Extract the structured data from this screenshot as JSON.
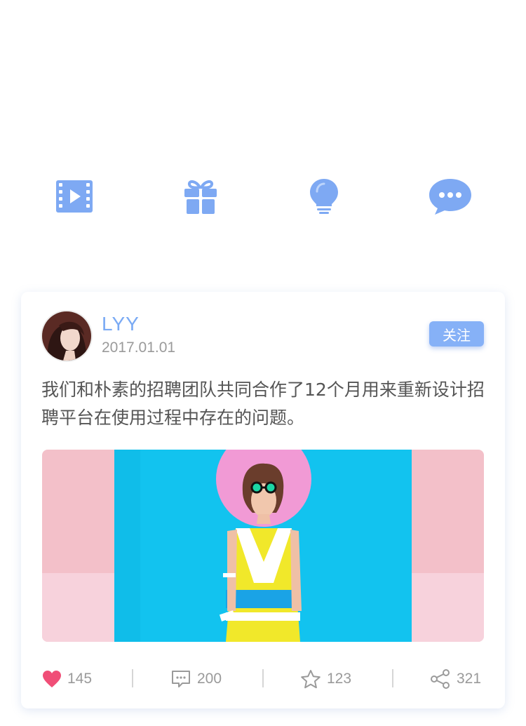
{
  "quick_icons": [
    {
      "name": "video-icon"
    },
    {
      "name": "gift-icon"
    },
    {
      "name": "lightbulb-icon"
    },
    {
      "name": "chat-bubble-icon"
    }
  ],
  "colors": {
    "accent": "#86b1f7",
    "icon_blue": "#7ea9f3",
    "like_red": "#f04e77",
    "text_main": "#555555",
    "text_muted": "#9a9a9a"
  },
  "post": {
    "username": "LYY",
    "date": "2017.01.01",
    "follow_label": "关注",
    "text": "我们和朴素的招聘团队共同合作了12个月用来重新设计招聘平台在使用过程中存在的问题。",
    "likes": "145",
    "comments": "200",
    "favorites": "123",
    "shares": "321"
  }
}
